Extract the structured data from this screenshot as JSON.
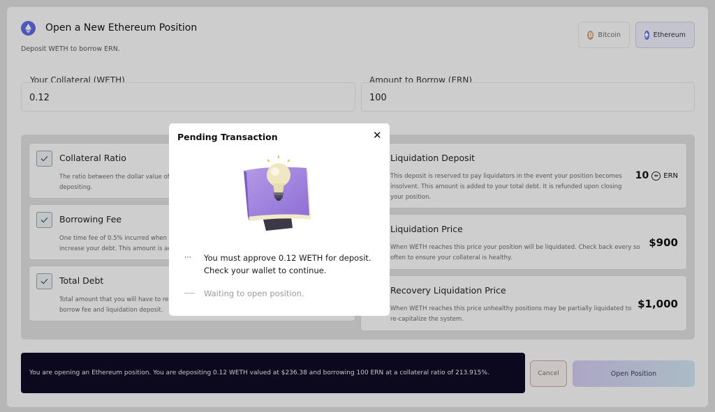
{
  "header": {
    "title": "Open a New Ethereum Position",
    "subtitle": "Deposit WETH to borrow ERN."
  },
  "chips": [
    {
      "label": "Bitcoin",
      "symbol": "₿",
      "selected": false
    },
    {
      "label": "Ethereum",
      "selected": true
    }
  ],
  "fields": {
    "collateral": {
      "label": "Your Collateral (WETH)",
      "value": "0.12"
    },
    "borrow": {
      "label": "Amount to Borrow (ERN)",
      "value": "100"
    }
  },
  "cards_left": [
    {
      "title": "Collateral Ratio",
      "desc1": "The ratio between the dollar value of",
      "desc2": "depositing."
    },
    {
      "title": "Borrowing Fee",
      "desc1": "One time fee of 0.5% incurred when",
      "desc2": "increase your debt. This amount is ad"
    },
    {
      "title": "Total Debt",
      "desc1": "Total amount that you will have to rep",
      "desc2": "borrow fee and liquidation deposit."
    }
  ],
  "cards_right": [
    {
      "title": "Liquidation Deposit",
      "desc": [
        "This deposit is reserved to pay liquidators in the event your position becomes",
        "insolvent. This amount is added to your total debt. It is refunded upon closing",
        "your position."
      ],
      "value": "10",
      "unit": "ERN"
    },
    {
      "title": "Liquidation Price",
      "desc": [
        "When WETH reaches this price your position will be liquidated. Check back every so",
        "often to ensure your collateral is healthy."
      ],
      "value": "$900"
    },
    {
      "title": "Recovery Liquidation Price",
      "desc": [
        "When WETH reaches this price unhealthy positions may be partially liquidated to",
        "re-capitalize the system."
      ],
      "value": "$1,000"
    }
  ],
  "summary": "You are opening an Ethereum position. You are depositing 0.12 WETH valued at $236.38 and borrowing 100 ERN at a collateral ratio of 213.915%.",
  "buttons": {
    "cancel": "Cancel",
    "open": "Open Position"
  },
  "modal": {
    "title": "Pending Transaction",
    "close": "✕",
    "steps": [
      {
        "line1": "You must approve 0.12 WETH for deposit.",
        "line2": "Check your wallet to continue.",
        "marker": "⋯",
        "active": true
      },
      {
        "line1": "Waiting to open position.",
        "active": false
      }
    ]
  }
}
